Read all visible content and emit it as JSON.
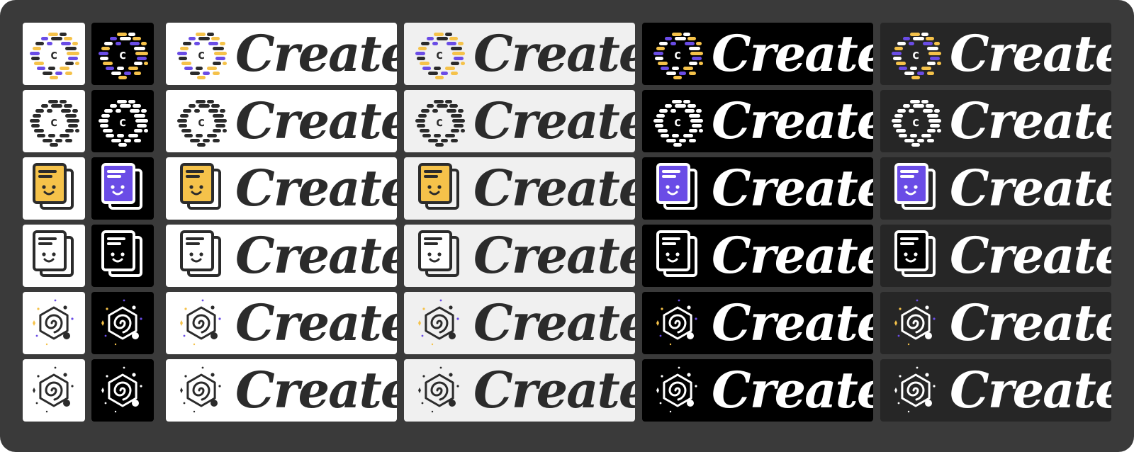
{
  "brand_word": "Create",
  "colors": {
    "sheet": "#3a3a3a",
    "white": "#ffffff",
    "light": "#f0f0f0",
    "black": "#000000",
    "dark": "#262626",
    "ink": "#2b2b2b",
    "purple": "#6a4ce6",
    "yellow": "#f5c24a"
  },
  "columns": [
    {
      "kind": "tile",
      "background": "white",
      "ink": "ink"
    },
    {
      "kind": "tile",
      "background": "black",
      "ink": "white"
    },
    {
      "kind": "banner",
      "background": "white",
      "ink": "ink"
    },
    {
      "kind": "banner",
      "background": "light",
      "ink": "ink"
    },
    {
      "kind": "banner",
      "background": "black",
      "ink": "white"
    },
    {
      "kind": "banner",
      "background": "dark",
      "ink": "white"
    }
  ],
  "rows": [
    {
      "icon": "dash-ring-icon",
      "variant": "color"
    },
    {
      "icon": "dash-ring-icon",
      "variant": "mono"
    },
    {
      "icon": "notebook-face-icon",
      "variant": "color"
    },
    {
      "icon": "notebook-face-icon",
      "variant": "mono"
    },
    {
      "icon": "galaxy-hexagon-icon",
      "variant": "color"
    },
    {
      "icon": "galaxy-hexagon-icon",
      "variant": "mono"
    }
  ]
}
